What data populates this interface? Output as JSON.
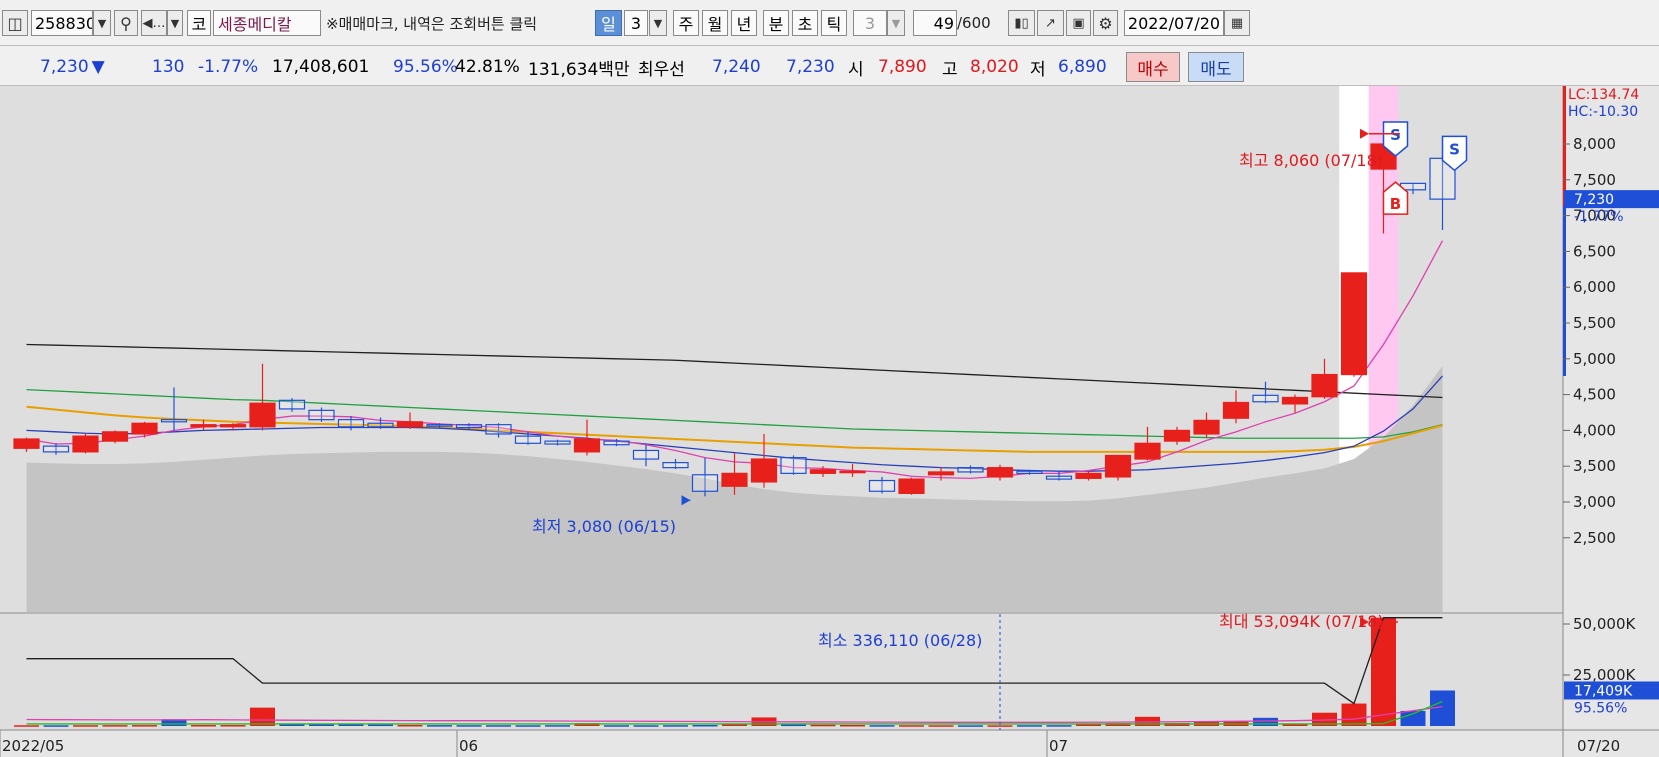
{
  "toolbar": {
    "code": "258830",
    "market_label": "코",
    "stock_name": "세종메디칼",
    "notice": "※매매마크, 내역은 조회버튼 클릭",
    "period_day": "일",
    "period_count": "3",
    "period_week": "주",
    "period_month": "월",
    "period_year": "년",
    "period_minute": "분",
    "period_second": "초",
    "period_tick": "틱",
    "interval_value": "3",
    "count_current": "49",
    "count_total": "/600",
    "date": "2022/07/20"
  },
  "quote": {
    "price": "7,230",
    "change": "130",
    "change_pct": "-1.77%",
    "volume": "17,408,601",
    "vol_ratio": "95.56%",
    "turnover": "42.81%",
    "amount": "131,634백만",
    "best_label": "최우선",
    "ask": "7,240",
    "bid": "7,230",
    "open_label": "시",
    "open": "7,890",
    "high_label": "고",
    "high": "8,020",
    "low_label": "저",
    "low": "6,890",
    "buy_label": "매수",
    "sell_label": "매도"
  },
  "annotations": {
    "max_price": "최고 8,060 (07/18)",
    "min_price": "최저 3,080 (06/15)",
    "max_volume": "최대 53,094K (07/18)",
    "min_volume": "최소 336,110 (06/28)",
    "lc": "LC:134.74",
    "hc": "HC:-10.30",
    "price_tag": "7,230",
    "price_pct": "-1.77%",
    "vol_tag": "17,409K",
    "vol_pct": "95.56%",
    "sell_mark": "S",
    "buy_mark": "B"
  },
  "colors": {
    "up": "#e8201c",
    "down": "#1f4fd6",
    "ma5": "#e040b0",
    "ma20": "#2a3fb8",
    "ma60": "#e8a000",
    "ma120": "#20a040",
    "ma240": "#202020",
    "band": "#c4c4c4"
  },
  "chart_data": {
    "type": "candlestick",
    "price_axis": {
      "ticks": [
        2500,
        3000,
        3500,
        4000,
        4500,
        5000,
        5500,
        6000,
        6500,
        7000,
        7500,
        8000
      ],
      "labels": [
        "2,500",
        "3,000",
        "3,500",
        "4,000",
        "4,500",
        "5,000",
        "5,500",
        "6,000",
        "6,500",
        "7,000",
        "7,500",
        "8,000"
      ]
    },
    "volume_axis": {
      "ticks": [
        25000000,
        50000000
      ],
      "labels": [
        "25,000K",
        "50,000K"
      ]
    },
    "x_labels": [
      {
        "index": 0,
        "label": "2022/05"
      },
      {
        "index": 15,
        "label": "06"
      },
      {
        "index": 35,
        "label": "07"
      },
      {
        "index": 48,
        "label": "07/20"
      }
    ],
    "candles": [
      {
        "o": 3750,
        "h": 3900,
        "l": 3700,
        "c": 3880
      },
      {
        "o": 3780,
        "h": 3820,
        "l": 3660,
        "c": 3700
      },
      {
        "o": 3700,
        "h": 3950,
        "l": 3680,
        "c": 3920
      },
      {
        "o": 3850,
        "h": 4000,
        "l": 3820,
        "c": 3980
      },
      {
        "o": 3950,
        "h": 4120,
        "l": 3900,
        "c": 4100
      },
      {
        "o": 4150,
        "h": 4600,
        "l": 4000,
        "c": 4120
      },
      {
        "o": 4050,
        "h": 4150,
        "l": 4000,
        "c": 4080
      },
      {
        "o": 4050,
        "h": 4100,
        "l": 4000,
        "c": 4080
      },
      {
        "o": 4050,
        "h": 4930,
        "l": 4000,
        "c": 4380
      },
      {
        "o": 4420,
        "h": 4450,
        "l": 4260,
        "c": 4300
      },
      {
        "o": 4280,
        "h": 4320,
        "l": 4120,
        "c": 4150
      },
      {
        "o": 4150,
        "h": 4200,
        "l": 4000,
        "c": 4050
      },
      {
        "o": 4100,
        "h": 4180,
        "l": 4020,
        "c": 4050
      },
      {
        "o": 4050,
        "h": 4250,
        "l": 4020,
        "c": 4120
      },
      {
        "o": 4080,
        "h": 4100,
        "l": 4040,
        "c": 4070
      },
      {
        "o": 4080,
        "h": 4100,
        "l": 4020,
        "c": 4040
      },
      {
        "o": 4080,
        "h": 4100,
        "l": 3900,
        "c": 3950
      },
      {
        "o": 3920,
        "h": 3980,
        "l": 3800,
        "c": 3820
      },
      {
        "o": 3850,
        "h": 3870,
        "l": 3790,
        "c": 3810
      },
      {
        "o": 3700,
        "h": 4150,
        "l": 3650,
        "c": 3880
      },
      {
        "o": 3850,
        "h": 3880,
        "l": 3780,
        "c": 3800
      },
      {
        "o": 3720,
        "h": 3800,
        "l": 3500,
        "c": 3600
      },
      {
        "o": 3550,
        "h": 3600,
        "l": 3460,
        "c": 3480
      },
      {
        "o": 3380,
        "h": 3620,
        "l": 3080,
        "c": 3150
      },
      {
        "o": 3220,
        "h": 3680,
        "l": 3100,
        "c": 3400
      },
      {
        "o": 3280,
        "h": 3950,
        "l": 3200,
        "c": 3600
      },
      {
        "o": 3620,
        "h": 3650,
        "l": 3380,
        "c": 3400
      },
      {
        "o": 3400,
        "h": 3500,
        "l": 3350,
        "c": 3450
      },
      {
        "o": 3420,
        "h": 3530,
        "l": 3350,
        "c": 3430
      },
      {
        "o": 3300,
        "h": 3350,
        "l": 3120,
        "c": 3150
      },
      {
        "o": 3120,
        "h": 3340,
        "l": 3100,
        "c": 3320
      },
      {
        "o": 3380,
        "h": 3480,
        "l": 3300,
        "c": 3420
      },
      {
        "o": 3480,
        "h": 3510,
        "l": 3400,
        "c": 3420
      },
      {
        "o": 3350,
        "h": 3520,
        "l": 3300,
        "c": 3480
      },
      {
        "o": 3430,
        "h": 3450,
        "l": 3380,
        "c": 3400
      },
      {
        "o": 3360,
        "h": 3430,
        "l": 3300,
        "c": 3320
      },
      {
        "o": 3330,
        "h": 3430,
        "l": 3300,
        "c": 3400
      },
      {
        "o": 3350,
        "h": 3650,
        "l": 3300,
        "c": 3650
      },
      {
        "o": 3600,
        "h": 4050,
        "l": 3580,
        "c": 3820
      },
      {
        "o": 3850,
        "h": 4050,
        "l": 3800,
        "c": 4000
      },
      {
        "o": 3950,
        "h": 4250,
        "l": 3900,
        "c": 4140
      },
      {
        "o": 4170,
        "h": 4560,
        "l": 4100,
        "c": 4390
      },
      {
        "o": 4490,
        "h": 4680,
        "l": 4380,
        "c": 4400
      },
      {
        "o": 4370,
        "h": 4500,
        "l": 4250,
        "c": 4460
      },
      {
        "o": 4470,
        "h": 5000,
        "l": 4440,
        "c": 4780
      },
      {
        "o": 4780,
        "h": 6200,
        "l": 4750,
        "c": 6200
      },
      {
        "o": 7650,
        "h": 8060,
        "l": 6750,
        "c": 8000
      },
      {
        "o": 7450,
        "h": 7450,
        "l": 7300,
        "c": 7360
      },
      {
        "o": 7800,
        "h": 7850,
        "l": 6800,
        "c": 7230
      }
    ],
    "volume": [
      360000,
      340000,
      380000,
      420000,
      440000,
      3300000,
      480000,
      460000,
      9000000,
      1100000,
      900000,
      800000,
      700000,
      500000,
      420000,
      400000,
      380000,
      360000,
      400000,
      1400000,
      380000,
      360000,
      400000,
      500000,
      1000000,
      4200000,
      700000,
      600000,
      500000,
      400000,
      380000,
      360000,
      340000,
      336110,
      380000,
      400000,
      1000000,
      1400000,
      4500000,
      1500000,
      2400000,
      2500000,
      4000000,
      1200000,
      6500000,
      11000000,
      53094000,
      7400000,
      17409000
    ],
    "ma5": [
      3880,
      3810,
      3820,
      3870,
      3920,
      4000,
      4050,
      4080,
      4150,
      4200,
      4200,
      4190,
      4140,
      4120,
      4090,
      4070,
      4040,
      3980,
      3920,
      3880,
      3860,
      3800,
      3720,
      3620,
      3560,
      3540,
      3480,
      3470,
      3440,
      3420,
      3360,
      3340,
      3330,
      3360,
      3400,
      3400,
      3440,
      3500,
      3560,
      3700,
      3860,
      3980,
      4120,
      4240,
      4400,
      4620,
      5200,
      5880,
      6650
    ],
    "ma20": [
      4000,
      3980,
      3960,
      3950,
      3960,
      3980,
      4000,
      4010,
      4020,
      4030,
      4040,
      4040,
      4040,
      4040,
      4030,
      4010,
      3980,
      3950,
      3920,
      3890,
      3850,
      3810,
      3770,
      3730,
      3690,
      3650,
      3610,
      3580,
      3550,
      3520,
      3500,
      3480,
      3470,
      3450,
      3440,
      3430,
      3430,
      3440,
      3450,
      3480,
      3510,
      3540,
      3580,
      3630,
      3690,
      3780,
      3990,
      4300,
      4760
    ],
    "ma60": [
      4330,
      4290,
      4250,
      4210,
      4180,
      4160,
      4140,
      4120,
      4110,
      4100,
      4090,
      4080,
      4070,
      4060,
      4040,
      4020,
      4000,
      3980,
      3960,
      3940,
      3920,
      3900,
      3880,
      3860,
      3840,
      3820,
      3800,
      3780,
      3760,
      3750,
      3740,
      3730,
      3720,
      3710,
      3700,
      3700,
      3700,
      3700,
      3700,
      3700,
      3700,
      3700,
      3700,
      3710,
      3730,
      3770,
      3850,
      3960,
      4070
    ],
    "ma120": [
      4570,
      4550,
      4530,
      4510,
      4490,
      4470,
      4450,
      4430,
      4420,
      4400,
      4380,
      4360,
      4340,
      4320,
      4300,
      4280,
      4260,
      4240,
      4220,
      4200,
      4180,
      4160,
      4140,
      4120,
      4100,
      4080,
      4060,
      4040,
      4020,
      4010,
      4000,
      3990,
      3980,
      3970,
      3960,
      3950,
      3940,
      3930,
      3920,
      3910,
      3900,
      3890,
      3890,
      3890,
      3890,
      3890,
      3910,
      3980,
      4080
    ],
    "ma240": [
      5200,
      5190,
      5180,
      5170,
      5160,
      5150,
      5140,
      5130,
      5120,
      5110,
      5100,
      5090,
      5080,
      5070,
      5060,
      5050,
      5040,
      5030,
      5020,
      5010,
      5000,
      4990,
      4980,
      4960,
      4940,
      4920,
      4900,
      4880,
      4860,
      4840,
      4820,
      4800,
      4780,
      4760,
      4740,
      4720,
      4700,
      4680,
      4660,
      4640,
      4620,
      4600,
      4580,
      4560,
      4540,
      4520,
      4500,
      4480,
      4460
    ],
    "band_lower": [
      3550,
      3540,
      3530,
      3530,
      3540,
      3560,
      3590,
      3620,
      3650,
      3670,
      3680,
      3690,
      3700,
      3700,
      3700,
      3690,
      3670,
      3640,
      3600,
      3560,
      3510,
      3460,
      3400,
      3330,
      3250,
      3180,
      3130,
      3100,
      3080,
      3060,
      3050,
      3040,
      3030,
      3020,
      3010,
      3010,
      3020,
      3050,
      3100,
      3150,
      3200,
      3270,
      3340,
      3400,
      3470,
      3600,
      3900,
      4350,
      4900
    ],
    "vol_ma": [
      3200000,
      3100000,
      3050000,
      3000000,
      3000000,
      3000000,
      3100000,
      3000000,
      2900000,
      2850000,
      2800000,
      2750000,
      2700000,
      2650000,
      2600000,
      2600000,
      2550000,
      2500000,
      2450000,
      2400000,
      2350000,
      2300000,
      2250000,
      2200000,
      2150000,
      2100000,
      2050000,
      2000000,
      1950000,
      1900000,
      1850000,
      1800000,
      1800000,
      1800000,
      1800000,
      1800000,
      1850000,
      1900000,
      2000000,
      2100000,
      2200000,
      2300000,
      2450000,
      2600000,
      2900000,
      3400000,
      5500000,
      7500000,
      9500000
    ],
    "vol_ma_long": [
      1000000,
      1000000,
      1000000,
      1000000,
      1000000,
      1000000,
      1000000,
      1000000,
      1000000,
      1000000,
      1000000,
      1000000,
      1000000,
      1000000,
      1000000,
      1000000,
      1000000,
      1000000,
      1000000,
      1000000,
      1000000,
      1000000,
      1000000,
      1000000,
      1000000,
      1000000,
      1000000,
      1000000,
      1000000,
      1000000,
      1000000,
      1000000,
      1000000,
      1000000,
      1000000,
      1000000,
      1000000,
      1000000,
      1000000,
      1000000,
      1000000,
      1000000,
      1000000,
      1000000,
      1000000,
      1000000,
      1200000,
      6000000,
      12000000
    ],
    "vol_max_line": [
      33000000,
      33000000,
      33000000,
      33000000,
      33000000,
      33000000,
      33000000,
      33000000,
      21000000,
      21000000,
      21000000,
      21000000,
      21000000,
      21000000,
      21000000,
      21000000,
      21000000,
      21000000,
      21000000,
      21000000,
      21000000,
      21000000,
      21000000,
      21000000,
      21000000,
      21000000,
      21000000,
      21000000,
      21000000,
      21000000,
      21000000,
      21000000,
      21000000,
      21000000,
      21000000,
      21000000,
      21000000,
      21000000,
      21000000,
      21000000,
      21000000,
      21000000,
      21000000,
      21000000,
      21000000,
      11000000,
      53094000,
      53094000,
      53094000
    ],
    "highlights": [
      {
        "index": 45,
        "color": "#ffffff"
      },
      {
        "index": 46,
        "color": "#ffc8f0"
      }
    ],
    "trade_marks": [
      {
        "index": 46,
        "type": "S",
        "price": 8000
      },
      {
        "index": 46,
        "type": "B",
        "price": 7300
      },
      {
        "index": 48,
        "type": "S",
        "price": 7800
      }
    ]
  }
}
